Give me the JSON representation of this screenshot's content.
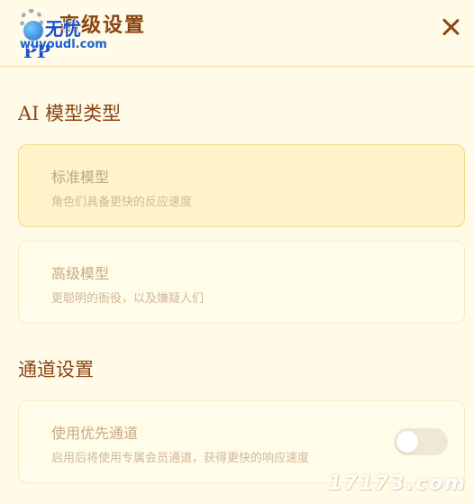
{
  "header": {
    "title": "高级设置",
    "close_icon": "close-icon"
  },
  "watermark": {
    "site_cn": "无忧PP",
    "site_url": "wuyoudl.com",
    "corner_text": "17173.com"
  },
  "model_section": {
    "title": "AI 模型类型",
    "options": [
      {
        "title": "标准模型",
        "desc": "角色们具备更快的反应速度",
        "selected": true
      },
      {
        "title": "高级模型",
        "desc": "更聪明的衙役，以及嫌疑人们",
        "selected": false
      }
    ]
  },
  "channel_section": {
    "title": "通道设置",
    "priority": {
      "title": "使用优先通道",
      "desc": "启用后将使用专属会员通道，获得更快的响应速度",
      "enabled": false
    }
  },
  "colors": {
    "background": "#fffbe8",
    "accent": "#8b4513",
    "selected_card": "#fff4c9"
  }
}
